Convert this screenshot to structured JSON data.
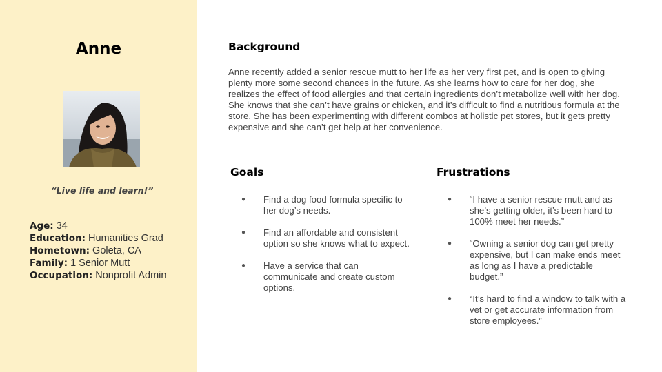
{
  "persona": {
    "name": "Anne",
    "photo_alt": "Anne portrait",
    "quote": "“Live life and learn!”",
    "facts": [
      {
        "label": "Age:",
        "value": " 34"
      },
      {
        "label": "Education:",
        "value": " Humanities Grad"
      },
      {
        "label": "Hometown:",
        "value": " Goleta, CA"
      },
      {
        "label": "Family:",
        "value": " 1 Senior Mutt"
      },
      {
        "label": "Occupation:",
        "value": " Nonprofit Admin"
      }
    ]
  },
  "background": {
    "title": "Background",
    "text": "Anne recently added a senior rescue mutt to her life as her very first pet, and is open to giving plenty more some second chances in the future. As she learns how to care for her dog, she realizes the effect of food allergies and that certain ingredients don’t metabolize well with her dog. She knows that she can’t have grains or chicken, and it’s difficult to find a nutritious formula at the store. She has been experimenting with different combos at holistic pet stores, but it gets pretty expensive and she can’t get help at her convenience."
  },
  "goals": {
    "title": "Goals",
    "items": [
      "Find a dog food formula specific to her dog’s needs.",
      "Find an affordable and consistent option so she knows what to expect.",
      "Have a service that can communicate and create custom options."
    ]
  },
  "frustrations": {
    "title": "Frustrations",
    "items": [
      "“I have a senior rescue mutt and as she’s getting older, it’s been hard to 100% meet her needs.”",
      "“Owning a senior dog can get pretty expensive, but I can make ends meet as long as I have a predictable budget.”",
      "“It’s hard to find a window to talk with a vet or get accurate information from store employees.”"
    ]
  },
  "bullet_glyph": "●",
  "colors": {
    "sidebar": "#fdf1c8"
  }
}
